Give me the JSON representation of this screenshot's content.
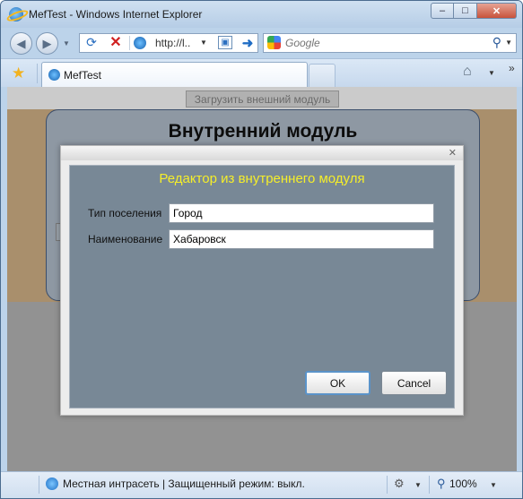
{
  "window": {
    "title": "MefTest - Windows Internet Explorer",
    "buttons": {
      "minimize": "–",
      "maximize": "□",
      "close": "✕"
    }
  },
  "navbar": {
    "address": "http://l..",
    "search_placeholder": "Google"
  },
  "tabs": [
    {
      "label": "MefTest"
    }
  ],
  "page": {
    "load_button_label": "Загрузить внешний модуль",
    "module_title": "Внутренний модуль"
  },
  "dialog": {
    "title": "Редактор из внутреннего модуля",
    "fields": [
      {
        "label": "Тип поселения",
        "value": "Город"
      },
      {
        "label": "Наименование",
        "value": "Хабаровск"
      }
    ],
    "ok_label": "OK",
    "cancel_label": "Cancel"
  },
  "statusbar": {
    "zone_text": "Местная интрасеть | Защищенный режим: выкл.",
    "zoom": "100%"
  },
  "colors": {
    "dialog_title": "#f5ee2a",
    "dialog_body": "#788896",
    "page_tan": "#a98f6c",
    "page_overlay": "#929292"
  },
  "icons": [
    "ie-icon",
    "back-icon",
    "forward-icon",
    "refresh-icon",
    "stop-icon",
    "compat-view-icon",
    "go-icon",
    "google-icon",
    "search-icon",
    "favorites-star-icon",
    "home-icon",
    "dialog-close-icon",
    "intranet-zone-icon",
    "protected-mode-icon",
    "zoom-icon"
  ]
}
